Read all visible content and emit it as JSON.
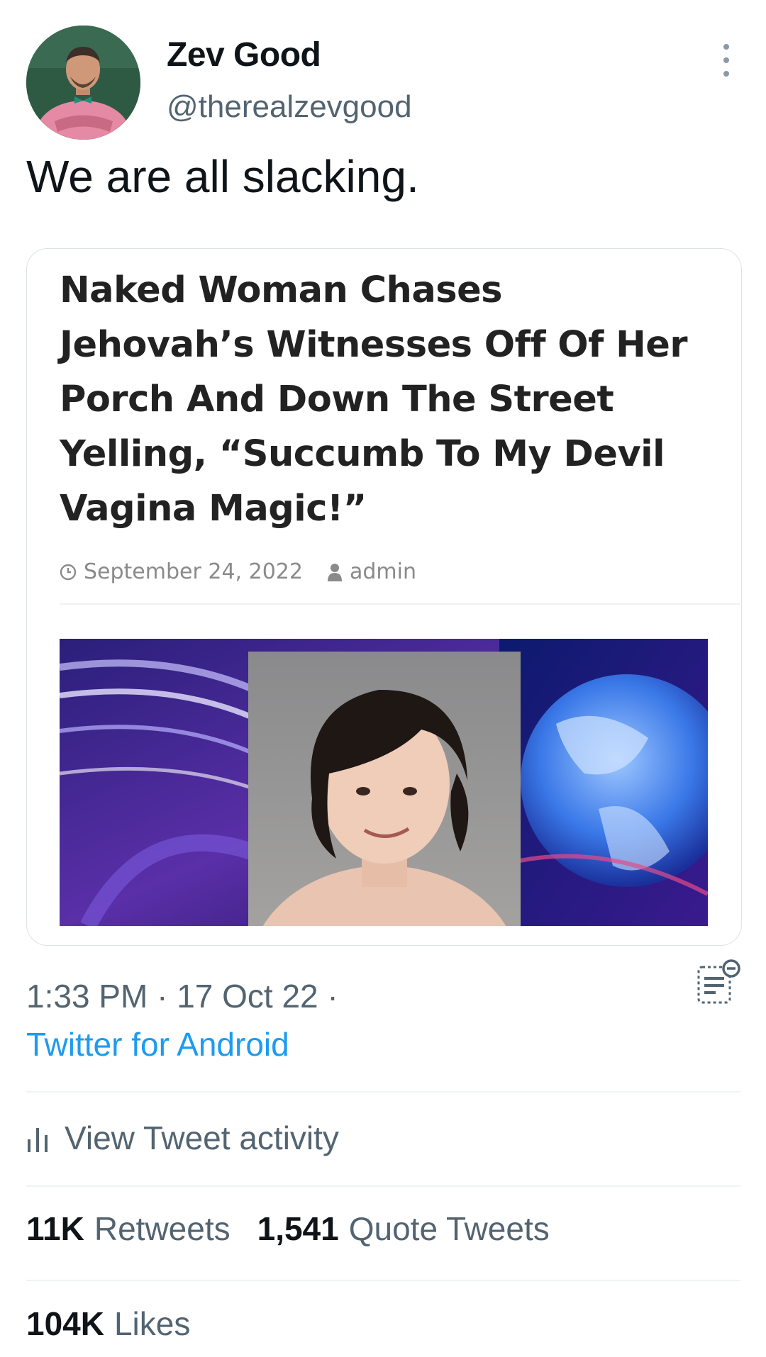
{
  "author": {
    "display_name": "Zev Good",
    "handle": "@therealzevgood"
  },
  "tweet": {
    "text": "We are all slacking."
  },
  "card": {
    "headline_lines": [
      "Naked Woman Chases",
      "Jehovah’s Witnesses Off Of Her",
      "Porch And Down The Street",
      "Yelling, “Succumb To My Devil",
      "Vagina Magic!”"
    ],
    "date": "September 24, 2022",
    "author": "admin"
  },
  "meta": {
    "timestamp": "1:33 PM · 17 Oct 22 ·",
    "source": "Twitter for Android"
  },
  "actions": {
    "activity_label": "View Tweet activity"
  },
  "stats": {
    "retweets_count": "11K",
    "retweets_label": "Retweets",
    "quotes_count": "1,541",
    "quotes_label": "Quote Tweets",
    "likes_count": "104K",
    "likes_label": "Likes"
  },
  "colors": {
    "text_primary": "#0f1419",
    "text_secondary": "#536471",
    "link": "#1d9bf0",
    "divider": "#eff3f4"
  },
  "icons": {
    "more": "more-vertical-icon",
    "hide_reply": "hide-reply-icon",
    "activity": "bar-chart-icon",
    "clock": "clock-icon",
    "user": "user-icon"
  }
}
